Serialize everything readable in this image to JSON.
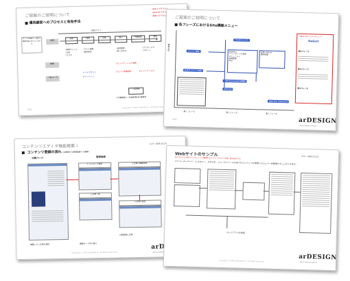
{
  "sheet1": {
    "title": "ご提案のご説明について",
    "heading": "優良顧客へのプロセスと有効手法",
    "process_label": "WEBサイト",
    "process_steps": [
      "参照",
      "認知",
      "理解",
      "比較",
      "関心",
      "発言",
      "一定関係",
      "予備顧客",
      "顧客"
    ],
    "left_rows": [
      "構築",
      "一般ユーザ"
    ],
    "legend": [
      "Web上で行うもの",
      "Web以外で行うもの",
      "実際に行うもの"
    ],
    "red_notes": [
      "コミュニケーション施策",
      "リピート誘導施策",
      "ポイントサービス"
    ],
    "blue_notes": [
      "メールマガジン",
      "キャンペーン"
    ],
    "footer_note": "※予備顧客→一気顧客育成の重要性",
    "side_text": "ネット利用者の一般的な購買行動に即したプロセス",
    "page_no": "2/51",
    "copyright": "Copyright © 2006 arDESIGN Inc. All Rights Reserved."
  },
  "sheet2": {
    "title": "ご提案のご説明について",
    "heading": "各フレーズにおけるSite構築メニュー",
    "y_axis": "構築主体",
    "phases": [
      "第１フレーズ",
      "第２フレーズ",
      "第３フレーズ"
    ],
    "callout_title": "今後のプロジェクトポイント",
    "callout_tag": "DaGuiI",
    "callout_sections": [
      "第1フレーズ",
      "第2フレーズ",
      "第3フレーズ"
    ],
    "pills": [
      "ブログサービス",
      "メンバー運営",
      "社内コンテンツ支援",
      "ATM Exclusive(24時間)",
      "ATM EXI",
      "Web Site Advanced"
    ],
    "menu_items": [
      "総合窓口",
      "ブランディング支援",
      "コミュニティ",
      "会員登録",
      "FAQ",
      "お問い合わせ",
      "更新管理"
    ],
    "page_no": "3/51",
    "logo": "arDESIGN",
    "logo_sub": "Web & Graphics Creative"
  },
  "sheet3": {
    "title": "コンテンツエディタ機能概要 I",
    "heading": "コンテンツ登録の流れ",
    "heading_note": "（公開部から登録画面への遷移）",
    "version": "v1.0 - 2006.10.29",
    "public_label": "公開ページ",
    "admin_label": "管理画面",
    "steps": [
      "1.コンテンツ選択",
      "2.記事一覧",
      "3.記事の編集画面",
      "4.記事の保存"
    ],
    "bottom_notes": [
      "編集したい記事を選択",
      "編集モード切り替え",
      "公開画面に反映"
    ],
    "logo": "arDESIGN",
    "logo_sub": "Web & Graphics Creative",
    "copyright": "Copyright © 2006 arDESIGN Inc. All Rights Reserved."
  },
  "sheet4": {
    "title": "Webサイトのサンプル",
    "version": "v1.0 - 2006.10.29",
    "lead": "エリコーディネイト、エコロジー、カタログ、ニュースリリースの全てのコンテンツを管理システムで一元管理することができます。",
    "red_note": "全てのページを同一テンプレートで運用することで、デザインの統一性を保ちます。",
    "caption": "ホレイアウト(全体図)",
    "logo": "arDESIGN",
    "logo_sub": "Web & Graphics Creative",
    "copyright": "Copyright © 2006 arDESIGN Inc. All Rights Reserved."
  }
}
